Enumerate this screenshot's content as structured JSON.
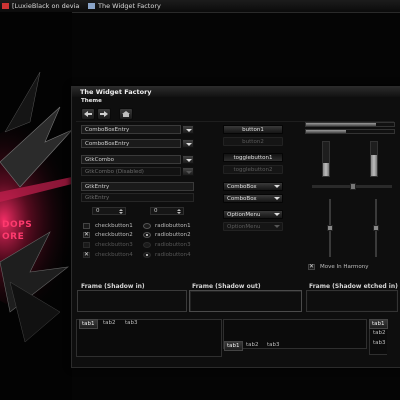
{
  "taskbar": {
    "items": [
      {
        "label": "[LuxieBlack on devian..."
      },
      {
        "label": "The Widget Factory"
      }
    ]
  },
  "desktop": {
    "art_text_1": "DOPS",
    "art_text_2": "ORE"
  },
  "window": {
    "title": "The Widget Factory",
    "menu_label": "Theme"
  },
  "combos": {
    "combo_entry_1": "ComboBoxEntry",
    "combo_entry_2": "ComboBoxEntry",
    "gtk_combo": "GtkCombo",
    "gtk_combo_disabled": "GtkCombo (Disabled)",
    "entry_1": "GtkEntry",
    "entry_2": "GtkEntry"
  },
  "spinners": {
    "spin_1": "0",
    "spin_2": "0"
  },
  "checks": [
    {
      "label": "checkbutton1",
      "checked": false
    },
    {
      "label": "checkbutton2",
      "checked": true
    },
    {
      "label": "checkbutton3",
      "checked": false
    },
    {
      "label": "checkbutton4",
      "checked": true
    }
  ],
  "radios": [
    {
      "label": "radiobutton1"
    },
    {
      "label": "radiobutton2"
    },
    {
      "label": "radiobutton3"
    },
    {
      "label": "radiobutton4"
    }
  ],
  "buttons": {
    "button1": "button1",
    "button2": "button2",
    "toggle1": "togglebutton1",
    "toggle2": "togglebutton2",
    "combobox_1": "ComboBox",
    "combobox_2": "ComboBox",
    "option_menu_1": "OptionMenu",
    "option_menu_2": "OptionMenu"
  },
  "progress": {
    "bar1": 0.8,
    "bar2": 0.45
  },
  "move_in_harmony": {
    "label": "Move In Harmony",
    "checked": true
  },
  "frames": {
    "shadow_in": "Frame (Shadow in)",
    "shadow_out": "Frame (Shadow out)",
    "shadow_etched_in": "Frame (Shadow etched in)"
  },
  "notebooks": {
    "top": [
      "tab1",
      "tab2",
      "tab3"
    ],
    "bottom": [
      "tab1",
      "tab2",
      "tab3"
    ],
    "right": [
      "tab1",
      "tab2",
      "tab3"
    ]
  },
  "colors": {
    "accent": "#ff3a6e",
    "background": "#050505"
  }
}
